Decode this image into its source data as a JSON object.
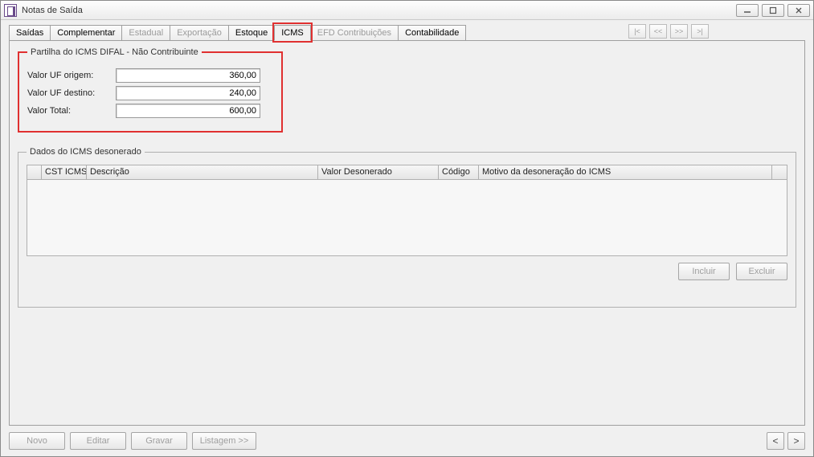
{
  "window": {
    "title": "Notas de Saída"
  },
  "tabs": [
    {
      "label": "Saídas",
      "enabled": true,
      "active": false
    },
    {
      "label": "Complementar",
      "enabled": true,
      "active": false
    },
    {
      "label": "Estadual",
      "enabled": false,
      "active": false
    },
    {
      "label": "Exportação",
      "enabled": false,
      "active": false
    },
    {
      "label": "Estoque",
      "enabled": true,
      "active": false
    },
    {
      "label": "ICMS",
      "enabled": true,
      "active": true
    },
    {
      "label": "EFD Contribuições",
      "enabled": false,
      "active": false
    },
    {
      "label": "Contabilidade",
      "enabled": true,
      "active": false
    }
  ],
  "nav": {
    "first": "|<",
    "prev": "<<",
    "next": ">>",
    "last": ">|"
  },
  "partilha": {
    "legend": "Partilha do ICMS DIFAL - Não Contribuinte",
    "rows": {
      "origem_label": "Valor UF origem:",
      "origem_value": "360,00",
      "destino_label": "Valor UF destino:",
      "destino_value": "240,00",
      "total_label": "Valor Total:",
      "total_value": "600,00"
    }
  },
  "desonerado": {
    "legend": "Dados do ICMS desonerado",
    "columns": {
      "cst": "CST ICMS",
      "descricao": "Descrição",
      "valor": "Valor Desonerado",
      "codigo": "Código",
      "motivo": "Motivo da desoneração do ICMS"
    },
    "buttons": {
      "incluir": "Incluir",
      "excluir": "Excluir"
    }
  },
  "footer": {
    "novo": "Novo",
    "editar": "Editar",
    "gravar": "Gravar",
    "listagem": "Listagem >>",
    "prev": "<",
    "next": ">"
  }
}
